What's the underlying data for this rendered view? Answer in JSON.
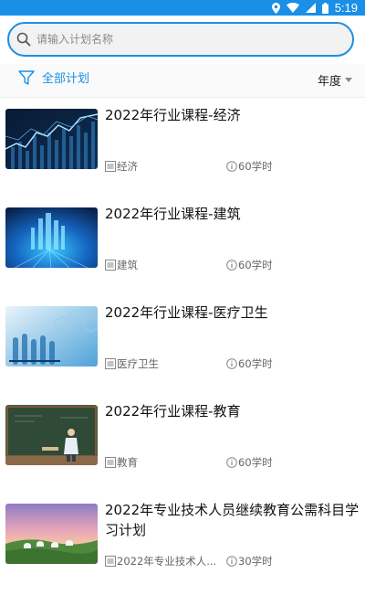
{
  "status_bar": {
    "time": "5:19",
    "icons": [
      "location-icon",
      "wifi-icon",
      "signal-icon",
      "battery-icon"
    ],
    "color": "#1a8fe6"
  },
  "search": {
    "placeholder": "请输入计划名称",
    "value": ""
  },
  "filter": {
    "all_label": "全部计划",
    "year_label": "年度"
  },
  "colors": {
    "accent": "#1a8fe6",
    "search_bg": "#f2f2f2"
  },
  "courses": [
    {
      "title": "2022年行业课程-经济",
      "category": "经济",
      "hours": "60学时",
      "thumb": "economy-chart"
    },
    {
      "title": "2022年行业课程-建筑",
      "category": "建筑",
      "hours": "60学时",
      "thumb": "blue-city-tech"
    },
    {
      "title": "2022年行业课程-医疗卫生",
      "category": "医疗卫生",
      "hours": "60学时",
      "thumb": "lab-test-tubes"
    },
    {
      "title": "2022年行业课程-教育",
      "category": "教育",
      "hours": "60学时",
      "thumb": "classroom-blackboard"
    },
    {
      "title": "2022年专业技术人员继续教育公需科目学习计划",
      "category": "2022年专业技术人...",
      "hours": "30学时",
      "thumb": "grassland-sunset"
    }
  ]
}
